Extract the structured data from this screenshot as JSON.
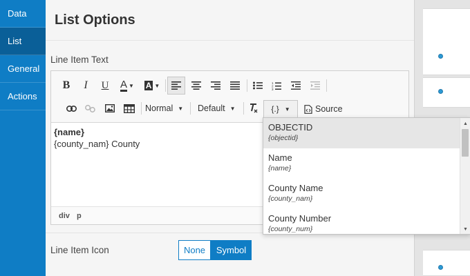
{
  "sidebar": {
    "items": [
      {
        "label": "Data",
        "active": false
      },
      {
        "label": "List",
        "active": true
      },
      {
        "label": "General",
        "active": false
      },
      {
        "label": "Actions",
        "active": false
      }
    ]
  },
  "panel": {
    "title": "List Options",
    "line_item_text_label": "Line Item Text",
    "line_item_icon_label": "Line Item Icon"
  },
  "toolbar": {
    "bold": "B",
    "italic": "I",
    "underline": "U",
    "font_color": "A",
    "highlight": "A",
    "format_select": "Normal",
    "size_select": "Default",
    "placeholder": "{.}",
    "source_label": "Source"
  },
  "editor": {
    "line1": "{name}",
    "line2": "{county_nam} County",
    "path": [
      "div",
      "p"
    ]
  },
  "icon_options": {
    "none": "None",
    "symbol": "Symbol",
    "selected": "Symbol"
  },
  "placeholder_dropdown": {
    "items": [
      {
        "name": "OBJECTID",
        "field": "{objectid}"
      },
      {
        "name": "Name",
        "field": "{name}"
      },
      {
        "name": "County Name",
        "field": "{county_nam}"
      },
      {
        "name": "County Number",
        "field": "{county_num}"
      }
    ]
  },
  "colors": {
    "sidebar": "#0f7dc5",
    "sidebar_active": "#0a5f98",
    "accent": "#0f7dc5",
    "marker": "#2b9ad6"
  },
  "icons": [
    "bold-icon",
    "italic-icon",
    "underline-icon",
    "font-color-icon",
    "highlight-color-icon",
    "align-left-icon",
    "align-center-icon",
    "align-right-icon",
    "align-justify-icon",
    "bulleted-list-icon",
    "numbered-list-icon",
    "decrease-indent-icon",
    "increase-indent-icon",
    "link-icon",
    "unlink-icon",
    "image-icon",
    "table-icon",
    "remove-format-icon",
    "source-icon"
  ]
}
